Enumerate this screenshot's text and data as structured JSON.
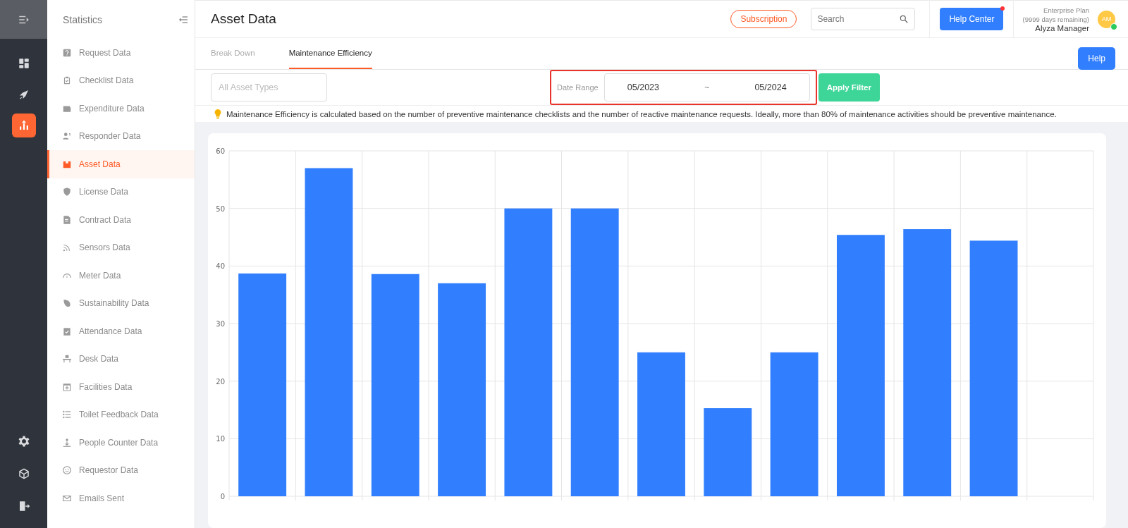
{
  "rail": {
    "items": [
      {
        "selected": false
      },
      {
        "selected": false
      },
      {
        "selected": true
      }
    ]
  },
  "sidebar": {
    "title": "Statistics",
    "items": [
      {
        "label": "Request Data",
        "selected": false
      },
      {
        "label": "Checklist Data",
        "selected": false
      },
      {
        "label": "Expenditure Data",
        "selected": false
      },
      {
        "label": "Responder Data",
        "selected": false
      },
      {
        "label": "Asset Data",
        "selected": true
      },
      {
        "label": "License Data",
        "selected": false
      },
      {
        "label": "Contract Data",
        "selected": false
      },
      {
        "label": "Sensors Data",
        "selected": false
      },
      {
        "label": "Meter Data",
        "selected": false
      },
      {
        "label": "Sustainability Data",
        "selected": false
      },
      {
        "label": "Attendance Data",
        "selected": false
      },
      {
        "label": "Desk Data",
        "selected": false
      },
      {
        "label": "Facilities Data",
        "selected": false
      },
      {
        "label": "Toilet Feedback Data",
        "selected": false
      },
      {
        "label": "People Counter Data",
        "selected": false
      },
      {
        "label": "Requestor Data",
        "selected": false
      },
      {
        "label": "Emails Sent",
        "selected": false
      }
    ]
  },
  "header": {
    "title": "Asset Data",
    "subscription": "Subscription",
    "search": {
      "placeholder": "Search"
    },
    "help_center": "Help Center",
    "help_center_notification": true,
    "plan": "Enterprise Plan",
    "plan_days": "(9999 days remaining)",
    "user": "Alyza Manager",
    "avatar": "AM",
    "online": true
  },
  "tabs": [
    {
      "label": "Break Down",
      "selected": false
    },
    {
      "label": "Maintenance Efficiency",
      "selected": true
    }
  ],
  "help_button": "Help",
  "filters": {
    "asset_types": {
      "placeholder": "All Asset Types"
    },
    "date_range_label": "Date Range",
    "date_from": "05/2023",
    "separator": "~",
    "date_to": "05/2024",
    "highlighted": true,
    "apply": "Apply Filter"
  },
  "info": "Maintenance Efficiency is calculated based on the number of preventive maintenance checklists and the number of reactive maintenance requests. Ideally, more than 80% of maintenance activities should be preventive maintenance.",
  "chart": {
    "chart_data": {
      "type": "bar",
      "grid": true,
      "ylim": [
        0,
        60
      ],
      "yticks": [
        0,
        10,
        20,
        30,
        40,
        50,
        60
      ],
      "series": [
        {
          "color": "#317ffe",
          "values": [
            38.7,
            57,
            38.6,
            37,
            50,
            50,
            25,
            15.3,
            25,
            45.4,
            46.4,
            44.4,
            null
          ]
        }
      ]
    }
  }
}
